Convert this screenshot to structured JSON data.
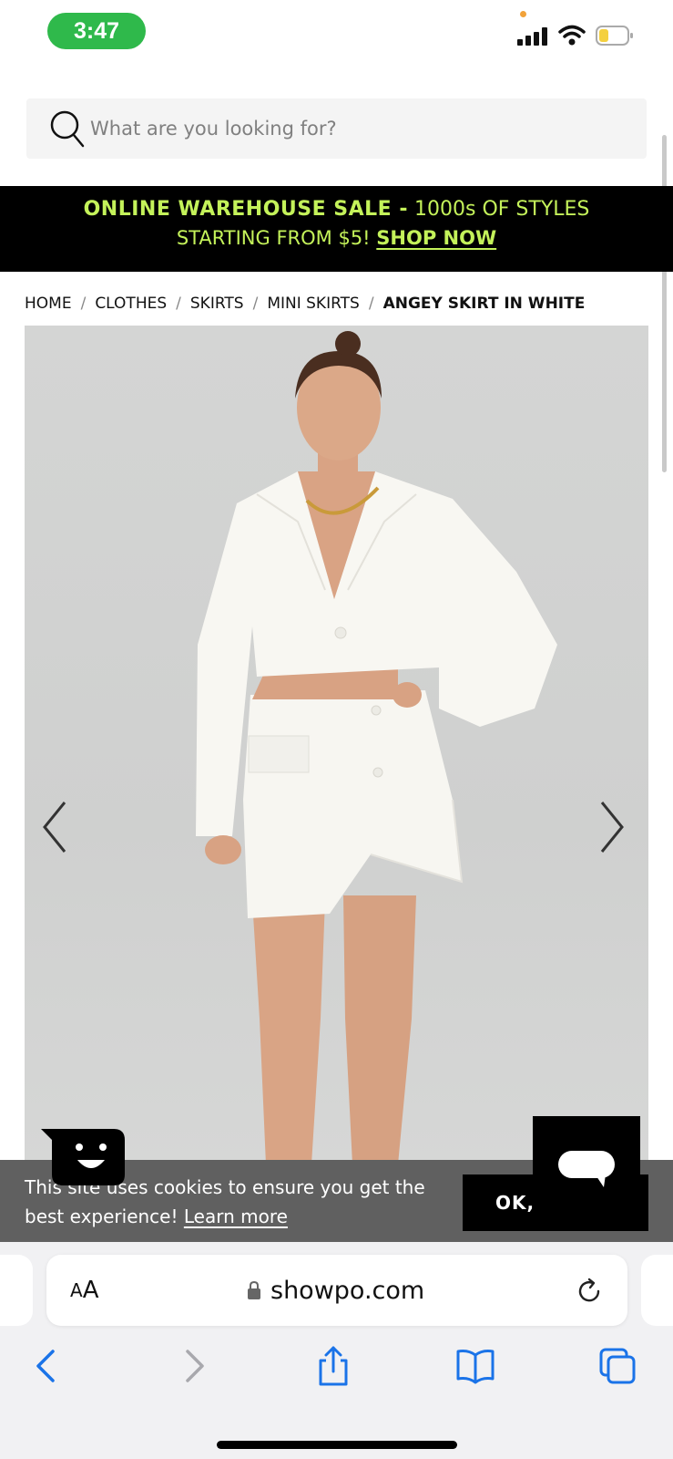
{
  "status_bar": {
    "time": "3:47",
    "icons": [
      "cellular-signal-icon",
      "wifi-icon",
      "battery-low-icon"
    ]
  },
  "search": {
    "placeholder": "What are you looking for?",
    "icon": "search-icon"
  },
  "promo": {
    "line1_bold": "ONLINE WAREHOUSE SALE -",
    "line1_rest": "1000s OF STYLES",
    "line2_text": "STARTING FROM $5!",
    "line2_link": "SHOP NOW",
    "text_color": "#c4f25a"
  },
  "breadcrumb": {
    "items": [
      "HOME",
      "CLOTHES",
      "SKIRTS",
      "MINI SKIRTS"
    ],
    "current": "ANGEY SKIRT IN WHITE",
    "separator": "/"
  },
  "product_image": {
    "alt_icon": "product-photo",
    "prev_icon": "chevron-left-icon",
    "next_icon": "chevron-right-icon"
  },
  "cookie_banner": {
    "text": "This site uses cookies to ensure you get the best experience!",
    "link": "Learn more",
    "ok_label": "OK,"
  },
  "browser": {
    "aa_label_small": "A",
    "aa_label_large": "A",
    "url": "showpo.com",
    "toolbar_icons": [
      "back-icon",
      "forward-icon",
      "share-icon",
      "bookmarks-icon",
      "tabs-icon"
    ]
  },
  "colors": {
    "time_pill": "#2fb94b",
    "promo_bg": "#000000",
    "promo_text": "#c4f25a",
    "cookie_bg": "#606060",
    "safari_blue": "#1a73e8"
  }
}
